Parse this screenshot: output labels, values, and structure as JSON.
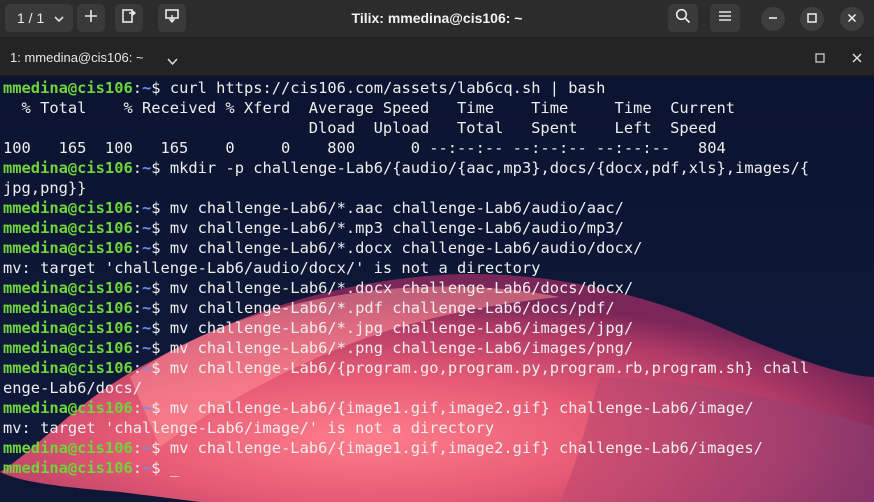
{
  "header": {
    "session_switcher_label": "1 / 1",
    "window_title": "Tilix: mmedina@cis106: ~"
  },
  "terminal_tab": {
    "title": "1: mmedina@cis106: ~"
  },
  "prompt": {
    "user_host": "mmedina@cis106",
    "colon": ":",
    "path": "~",
    "symbol": "$ "
  },
  "cursor": "_",
  "lines": [
    {
      "type": "prompt",
      "cmd": "curl https://cis106.com/assets/lab6cq.sh | bash"
    },
    {
      "type": "output",
      "text": "  % Total    % Received % Xferd  Average Speed   Time    Time     Time  Current"
    },
    {
      "type": "output",
      "text": "                                 Dload  Upload   Total   Spent    Left  Speed"
    },
    {
      "type": "output",
      "text": "100   165  100   165    0     0    800      0 --:--:-- --:--:-- --:--:--   804"
    },
    {
      "type": "prompt",
      "cmd": "mkdir -p challenge-Lab6/{audio/{aac,mp3},docs/{docx,pdf,xls},images/{"
    },
    {
      "type": "output",
      "text": "jpg,png}}"
    },
    {
      "type": "prompt",
      "cmd": "mv challenge-Lab6/*.aac challenge-Lab6/audio/aac/"
    },
    {
      "type": "prompt",
      "cmd": "mv challenge-Lab6/*.mp3 challenge-Lab6/audio/mp3/"
    },
    {
      "type": "prompt",
      "cmd": "mv challenge-Lab6/*.docx challenge-Lab6/audio/docx/"
    },
    {
      "type": "output",
      "text": "mv: target 'challenge-Lab6/audio/docx/' is not a directory"
    },
    {
      "type": "prompt",
      "cmd": "mv challenge-Lab6/*.docx challenge-Lab6/docs/docx/"
    },
    {
      "type": "prompt",
      "cmd": "mv challenge-Lab6/*.pdf challenge-Lab6/docs/pdf/"
    },
    {
      "type": "prompt",
      "cmd": "mv challenge-Lab6/*.jpg challenge-Lab6/images/jpg/"
    },
    {
      "type": "prompt",
      "cmd": "mv challenge-Lab6/*.png challenge-Lab6/images/png/"
    },
    {
      "type": "prompt",
      "cmd": "mv challenge-Lab6/{program.go,program.py,program.rb,program.sh} chall"
    },
    {
      "type": "output",
      "text": "enge-Lab6/docs/"
    },
    {
      "type": "prompt",
      "cmd": "mv challenge-Lab6/{image1.gif,image2.gif} challenge-Lab6/image/"
    },
    {
      "type": "output",
      "text": "mv: target 'challenge-Lab6/image/' is not a directory"
    },
    {
      "type": "prompt",
      "cmd": "mv challenge-Lab6/{image1.gif,image2.gif} challenge-Lab6/images/"
    },
    {
      "type": "prompt",
      "cmd": "",
      "cursor": true
    }
  ],
  "icons": {
    "session_chevron": "chevron-down-icon",
    "add": "plus-icon",
    "split_right": "split-right-icon",
    "split_down": "split-down-icon",
    "search": "search-icon",
    "menu": "hamburger-menu-icon",
    "minimize": "minimize-icon",
    "maximize": "maximize-icon",
    "close": "close-icon",
    "terminal_title_chevron": "chevron-down-icon",
    "terminal_maximize": "maximize-icon",
    "terminal_close": "close-icon"
  },
  "colors": {
    "prompt_user": "#6fd53a",
    "prompt_path": "#6d8ff0",
    "text": "#eeeeee",
    "background": "#0b1430",
    "headerbar": "#2c2c2c",
    "wallpaper_accent": "#e35d74"
  }
}
